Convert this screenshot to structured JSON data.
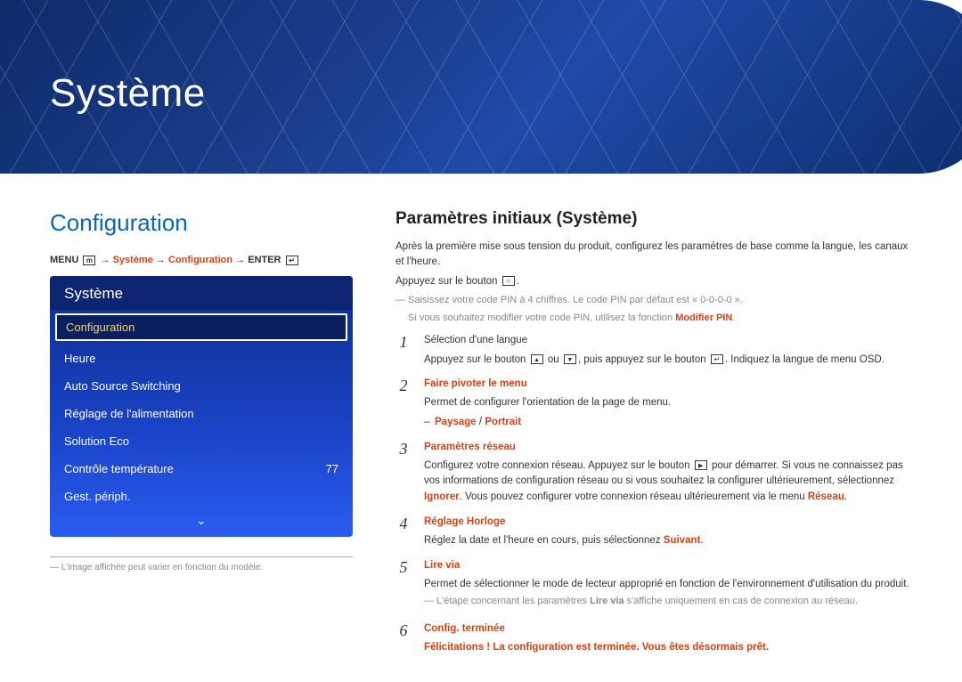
{
  "chapter": {
    "title": "Système"
  },
  "left": {
    "section_title": "Configuration",
    "breadcrumb": {
      "menu": "MENU",
      "arrow": " → ",
      "p1": "Système",
      "p2": "Configuration",
      "enter": "ENTER"
    },
    "panel": {
      "title": "Système",
      "items": [
        {
          "label": "Configuration",
          "value": "",
          "selected": true
        },
        {
          "label": "Heure",
          "value": ""
        },
        {
          "label": "Auto Source Switching",
          "value": ""
        },
        {
          "label": "Réglage de l'alimentation",
          "value": ""
        },
        {
          "label": "Solution Eco",
          "value": ""
        },
        {
          "label": "Contrôle température",
          "value": "77"
        },
        {
          "label": "Gest. périph.",
          "value": ""
        }
      ],
      "more_glyph": "⌄"
    },
    "footnote": "L'image affichée peut varier en fonction du modèle."
  },
  "right": {
    "heading": "Paramètres initiaux (Système)",
    "intro1": "Après la première mise sous tension du produit, configurez les paramètres de base comme la langue, les canaux et l'heure.",
    "intro2_prefix": "Appuyez sur le bouton ",
    "intro2_suffix": ".",
    "pin_note1": "Saisissez votre code PIN à 4 chiffres. Le code PIN par défaut est « 0-0-0-0 ».",
    "pin_note2_pre": "Si vous souhaitez modifier votre code PIN, utilisez la fonction ",
    "pin_note2_bold": "Modifier PIN",
    "pin_note2_post": ".",
    "steps": [
      {
        "num": "1",
        "line1": "Sélection d'une langue",
        "line2_pre": "Appuyez sur le bouton ",
        "line2_mid": " ou ",
        "line2_mid2": ", puis appuyez sur le bouton ",
        "line2_post": ". Indiquez la langue de menu OSD."
      },
      {
        "num": "2",
        "title": "Faire pivoter le menu",
        "line1": "Permet de configurer l'orientation de la page de menu.",
        "sub_p1": "Paysage",
        "sub_sep": " / ",
        "sub_p2": "Portrait"
      },
      {
        "num": "3",
        "title": "Paramètres réseau",
        "line1_pre": "Configurez votre connexion réseau. Appuyez sur le bouton ",
        "line1_post": " pour démarrer. Si vous ne connaissez pas vos informations de configuration réseau ou si vous souhaitez la configurer ultérieurement, sélectionnez ",
        "ignore": "Ignorer",
        "line1_post2": ". Vous pouvez configurer votre connexion réseau ultérieurement via le menu ",
        "reseau": "Réseau",
        "line1_post3": "."
      },
      {
        "num": "4",
        "title": "Réglage Horloge",
        "line1_pre": "Réglez la date et l'heure en cours, puis sélectionnez ",
        "suivant": "Suivant",
        "line1_post": "."
      },
      {
        "num": "5",
        "title": "Lire via",
        "line1": "Permet de sélectionner le mode de lecteur approprié en fonction de l'environnement d'utilisation du produit.",
        "note_pre": "L'étape concernant les paramètres ",
        "note_bold": "Lire via",
        "note_post": " s'affiche uniquement en cas de connexion au réseau."
      },
      {
        "num": "6",
        "title": "Config. terminée",
        "line1": "Félicitations ! La configuration est terminée. Vous êtes désormais prêt."
      }
    ]
  }
}
